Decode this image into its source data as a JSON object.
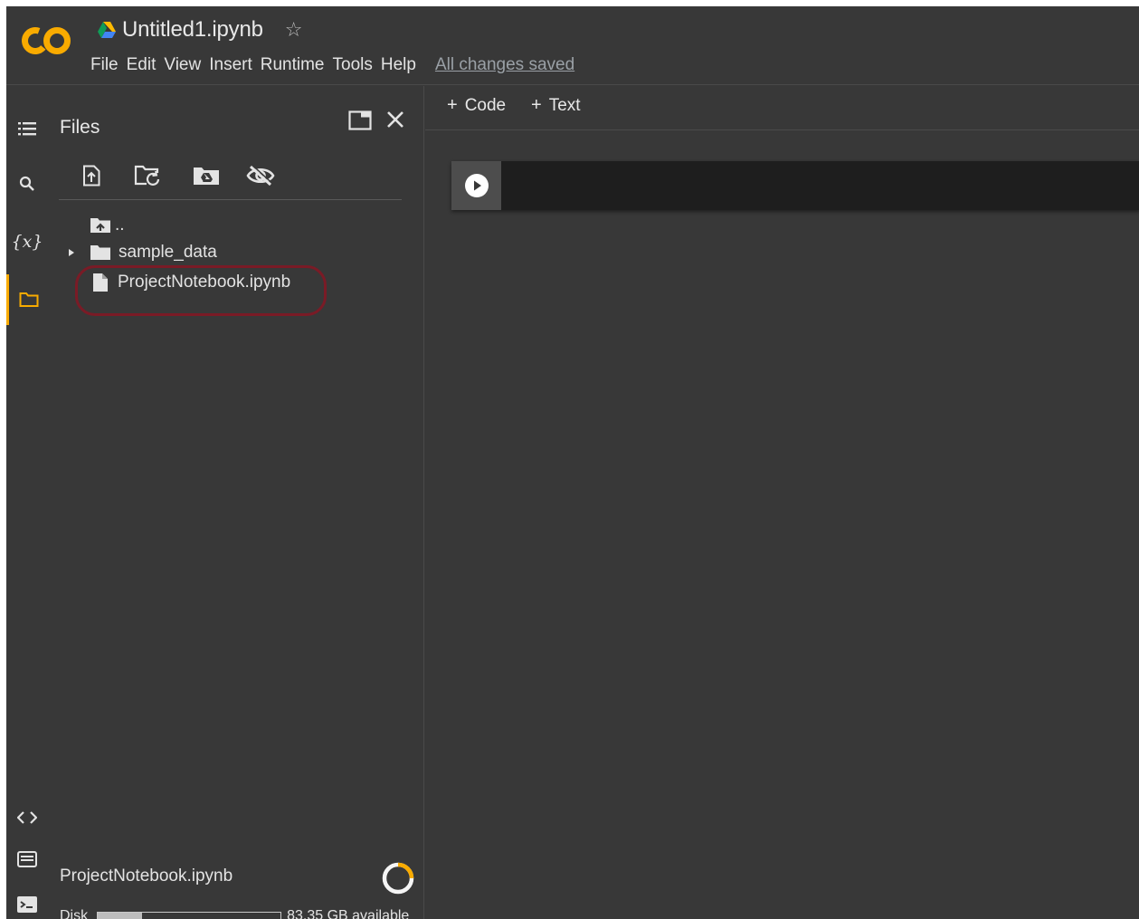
{
  "header": {
    "app_logo_text": "CO",
    "doc_title": "Untitled1.ipynb",
    "star_icon": "star-outline-icon",
    "menu": [
      "File",
      "Edit",
      "View",
      "Insert",
      "Runtime",
      "Tools",
      "Help"
    ],
    "save_status": "All changes saved"
  },
  "rail": {
    "items": [
      {
        "name": "table-of-contents",
        "icon": "list-icon"
      },
      {
        "name": "search",
        "icon": "search-icon"
      },
      {
        "name": "variables",
        "icon": "variables-icon",
        "glyph": "{x}"
      },
      {
        "name": "files",
        "icon": "folder-icon",
        "active": true
      },
      {
        "name": "code-snippets",
        "icon": "code-icon",
        "glyph": "<>"
      },
      {
        "name": "command-palette",
        "icon": "keyboard-icon"
      },
      {
        "name": "terminal",
        "icon": "terminal-icon"
      }
    ]
  },
  "files_panel": {
    "title": "Files",
    "toolbar": [
      "upload-file-icon",
      "refresh-folder-icon",
      "mount-drive-icon",
      "hide-files-icon"
    ],
    "tree": [
      {
        "label": "..",
        "type": "parent-folder"
      },
      {
        "label": "sample_data",
        "type": "folder",
        "collapsed": true
      },
      {
        "label": "ProjectNotebook.ipynb",
        "type": "file",
        "highlighted": true
      }
    ],
    "footer": {
      "file": "ProjectNotebook.ipynb",
      "disk_label": "Disk",
      "disk_used_fraction": 0.24,
      "disk_available": "83.35 GB available"
    }
  },
  "main": {
    "add_code": "Code",
    "add_text": "Text"
  },
  "colors": {
    "background": "#383838",
    "accent": "#f9ab00",
    "highlight_ring": "#7a1b26",
    "cell": "#1e1e1e"
  }
}
